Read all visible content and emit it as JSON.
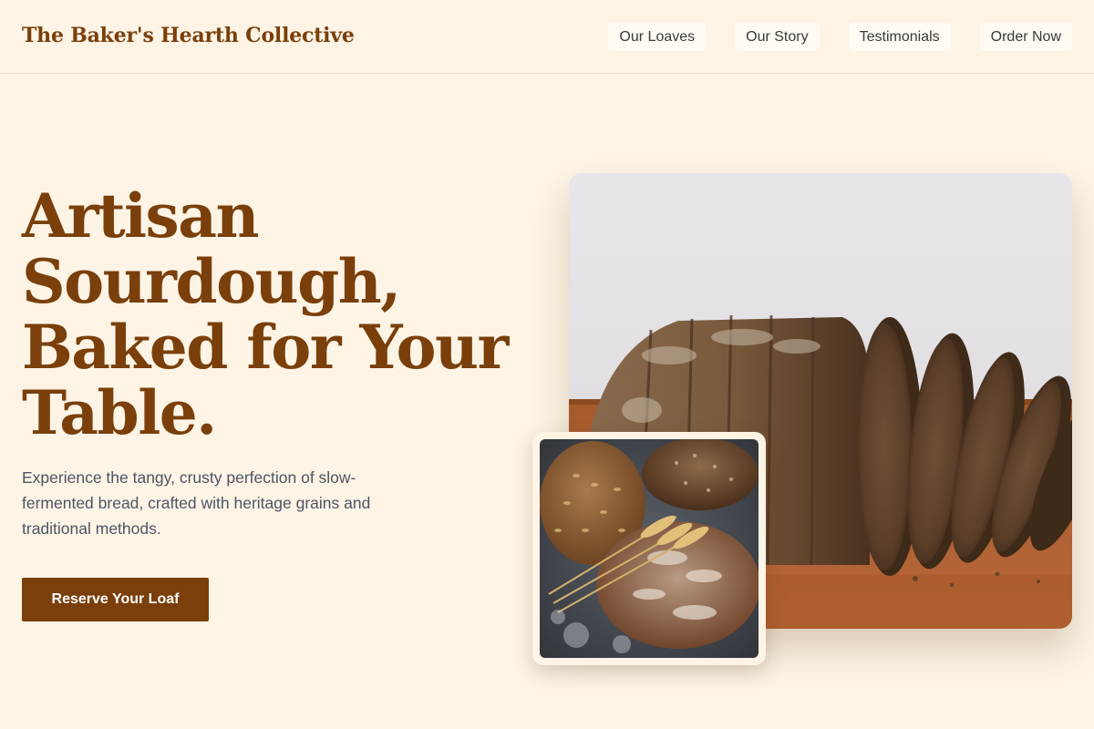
{
  "header": {
    "brand": "The Baker's Hearth Collective",
    "nav": [
      "Our Loaves",
      "Our Story",
      "Testimonials",
      "Order Now"
    ]
  },
  "hero": {
    "title_lines": [
      "Artisan",
      "Sourdough,",
      "Baked for Your",
      "Table."
    ],
    "description": "Experience the tangy, crusty perfection of slow-fermented bread, crafted with heritage grains and traditional methods.",
    "cta_label": "Reserve Your Loaf"
  },
  "images": {
    "main": "sliced-sourdough-loaf-photo",
    "secondary": "seeded-breads-and-wheat-photo"
  },
  "colors": {
    "background": "#fdf4e6",
    "brand": "#7a3f0a",
    "nav_chip": "#fffaf2",
    "body_text": "#4b5563"
  }
}
